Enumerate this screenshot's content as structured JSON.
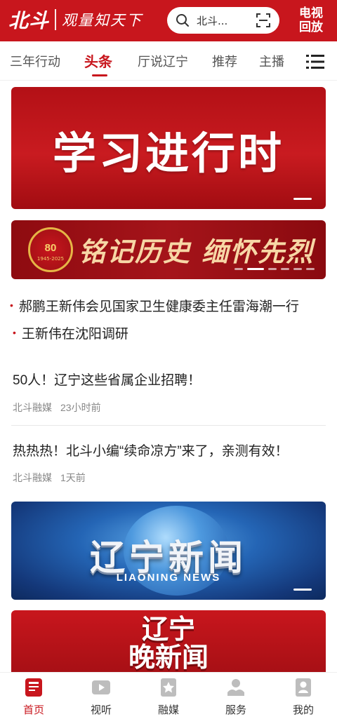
{
  "header": {
    "logo": "北斗",
    "slogan": "观量知天下",
    "search_text": "北斗...",
    "tv_replay_line1": "电视",
    "tv_replay_line2": "回放"
  },
  "tabs": [
    {
      "label": "三年行动",
      "active": false
    },
    {
      "label": "头条",
      "active": true
    },
    {
      "label": "厅说辽宁",
      "active": false
    },
    {
      "label": "推荐",
      "active": false
    },
    {
      "label": "主播",
      "active": false
    }
  ],
  "banners": {
    "study": "学习进行时",
    "remember_badge": "80",
    "remember_years": "1945-2025",
    "remember_text": "铭记历史 缅怀先烈",
    "liaoning_news": "辽宁新闻",
    "liaoning_news_en": "LIAONING NEWS",
    "evening_news_line1": "辽宁",
    "evening_news_line2": "晚新闻"
  },
  "headlines": [
    "郝鹏王新伟会见国家卫生健康委主任雷海潮一行",
    "王新伟在沈阳调研"
  ],
  "news": [
    {
      "title": "50人！辽宁这些省属企业招聘！",
      "source": "北斗融媒",
      "time": "23小时前"
    },
    {
      "title": "热热热！北斗小编“续命凉方”来了，亲测有效！",
      "source": "北斗融媒",
      "time": "1天前"
    }
  ],
  "bottom_nav": [
    {
      "label": "首页",
      "active": true,
      "icon": "home-icon"
    },
    {
      "label": "视听",
      "active": false,
      "icon": "video-icon"
    },
    {
      "label": "融媒",
      "active": false,
      "icon": "star-icon"
    },
    {
      "label": "服务",
      "active": false,
      "icon": "service-icon"
    },
    {
      "label": "我的",
      "active": false,
      "icon": "profile-icon"
    }
  ],
  "colors": {
    "brand": "#c8161d"
  }
}
